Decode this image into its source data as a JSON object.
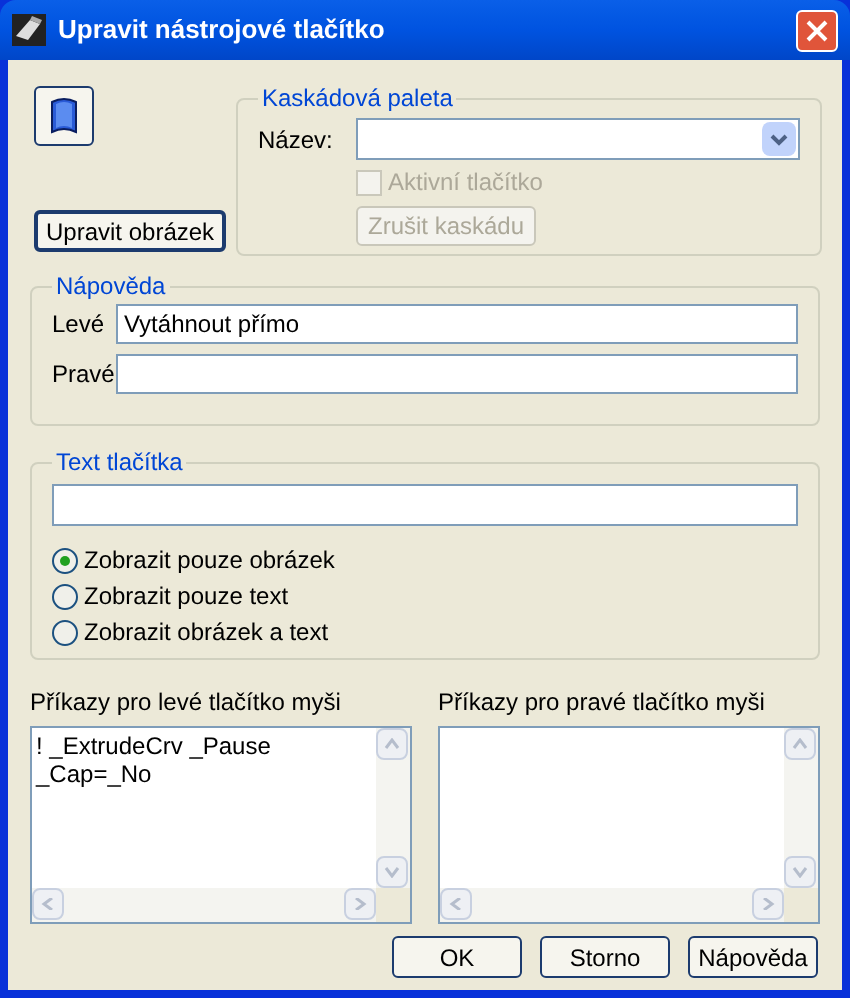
{
  "window": {
    "title": "Upravit nástrojové tlačítko"
  },
  "edit_image_button": "Upravit obrázek",
  "cascade": {
    "title": "Kaskádová paleta",
    "name_label": "Název:",
    "active_checkbox": {
      "label": "Aktivní tlačítko",
      "checked": false,
      "disabled": true
    },
    "cancel_button": {
      "label": "Zrušit kaskádu",
      "disabled": true
    }
  },
  "tooltip": {
    "title": "Nápověda",
    "fields": [
      {
        "label": "Levé",
        "value": "Vytáhnout přímo"
      },
      {
        "label": "Pravé"
      }
    ]
  },
  "button_text": {
    "title": "Text tlačítka",
    "options": [
      {
        "label": "Zobrazit pouze obrázek",
        "selected": true
      },
      {
        "label": "Zobrazit pouze text",
        "selected": false
      },
      {
        "label": "Zobrazit obrázek a text",
        "selected": false
      }
    ]
  },
  "commands": [
    {
      "label": "Příkazy pro levé tlačítko myši",
      "lines": [
        "! _ExtrudeCrv _Pause",
        "_Cap=_No"
      ]
    },
    {
      "label": "Příkazy pro pravé tlačítko myši"
    }
  ],
  "buttons": [
    "OK",
    "Storno",
    "Nápověda"
  ]
}
